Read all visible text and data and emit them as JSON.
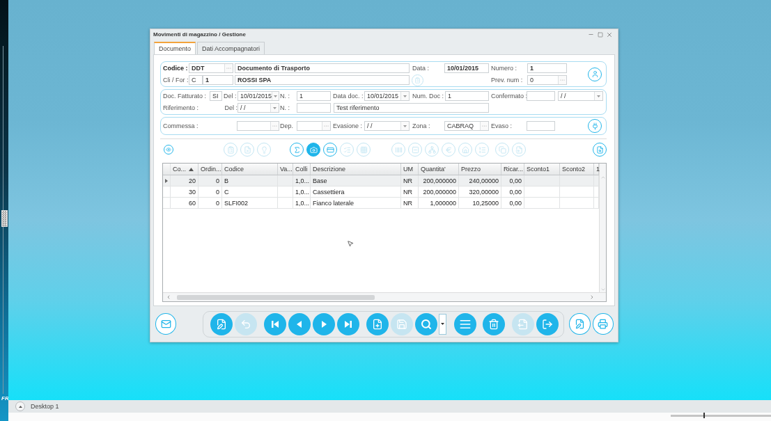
{
  "desktop": {
    "side_label": "FR"
  },
  "window": {
    "title": "Movimenti di magazzino / Gestione"
  },
  "tabs": [
    {
      "label": "Documento",
      "selected": true
    },
    {
      "label": "Dati Accompagnatori",
      "selected": false
    }
  ],
  "header_group": {
    "codice": {
      "label": "Codice :",
      "value": "DDT"
    },
    "descrizione": "Documento di Trasporto",
    "data": {
      "label": "Data :",
      "value": "10/01/2015"
    },
    "numero": {
      "label": "Numero :",
      "value": "1"
    },
    "cli_for": {
      "label": "Cli / For :",
      "type": "C",
      "code": "1",
      "name": "ROSSI SPA"
    },
    "prev_num": {
      "label": "Prev. num :",
      "value": "0"
    }
  },
  "billing_group": {
    "doc_fatturato": {
      "label": "Doc. Fatturato :",
      "value": "SI"
    },
    "del": {
      "label": "Del :",
      "value": "10/01/2015"
    },
    "n": {
      "label": "N. :",
      "value": "1"
    },
    "data_doc": {
      "label": "Data doc. :",
      "value": "10/01/2015"
    },
    "num_doc": {
      "label": "Num. Doc :",
      "value": "1"
    },
    "confermato": {
      "label": "Confermato :",
      "date": "/ /"
    },
    "riferimento": {
      "label": "Riferimento :"
    },
    "rif_del": {
      "label": "Del :",
      "value": "/ /"
    },
    "rif_n": {
      "label": "N. :"
    },
    "rif_text": "Test riferimento"
  },
  "order_group": {
    "commessa": {
      "label": "Commessa :"
    },
    "dep": {
      "label": "Dep."
    },
    "evasione": {
      "label": "Evasione :",
      "value": "/ /"
    },
    "zona": {
      "label": "Zona :",
      "value": "CABRAQ"
    },
    "evaso": {
      "label": "Evaso :"
    }
  },
  "toolbar": {
    "groups": [
      [
        {
          "disabled": true,
          "pressed": false
        },
        {
          "disabled": true,
          "pressed": false
        },
        {
          "disabled": true,
          "pressed": false
        }
      ],
      [
        {
          "disabled": false,
          "pressed": false
        },
        {
          "disabled": false,
          "pressed": true
        },
        {
          "disabled": false,
          "pressed": false
        },
        {
          "disabled": true,
          "pressed": false
        },
        {
          "disabled": true,
          "pressed": false
        }
      ],
      [
        {
          "disabled": true,
          "pressed": false
        },
        {
          "disabled": true,
          "pressed": false
        },
        {
          "disabled": true,
          "pressed": false
        },
        {
          "disabled": true,
          "pressed": false
        },
        {
          "disabled": true,
          "pressed": false
        },
        {
          "disabled": true,
          "pressed": false
        }
      ],
      [
        {
          "disabled": true,
          "pressed": false
        },
        {
          "disabled": true,
          "pressed": false
        }
      ]
    ]
  },
  "grid": {
    "columns": [
      {
        "label": "Co...",
        "sorted": true
      },
      {
        "label": "Ordin...",
        "sorted": false
      },
      {
        "label": "Codice",
        "sorted": false
      },
      {
        "label": "Va...",
        "sorted": false
      },
      {
        "label": "Colli",
        "sorted": false
      },
      {
        "label": "Descrizione",
        "sorted": false
      },
      {
        "label": "UM",
        "sorted": false
      },
      {
        "label": "Quantita'",
        "sorted": false
      },
      {
        "label": "Prezzo",
        "sorted": false
      },
      {
        "label": "Ricar...",
        "sorted": false
      },
      {
        "label": "Sconto1",
        "sorted": false
      },
      {
        "label": "Sconto2",
        "sorted": false
      },
      {
        "label": "1",
        "sorted": false
      }
    ],
    "rows": [
      {
        "selected": true,
        "cells": [
          "20",
          "0",
          "B",
          null,
          "1,0...",
          "Base",
          "NR",
          "200,000000",
          "240,00000",
          "0,00",
          null,
          null,
          null
        ]
      },
      {
        "selected": false,
        "cells": [
          "30",
          "0",
          "C",
          null,
          "1,0...",
          "Cassettiera",
          "NR",
          "200,000000",
          "320,00000",
          "0,00",
          null,
          null,
          null
        ]
      },
      {
        "selected": false,
        "cells": [
          "60",
          "0",
          "SLFI002",
          null,
          "1,0...",
          "Fianco laterale",
          "NR",
          "1,000000",
          "10,25000",
          "0,00",
          null,
          null,
          null
        ]
      }
    ]
  },
  "bottom_bar": {
    "left": [
      {
        "disabled": false
      }
    ],
    "nav_groups": [
      [
        {
          "kind": "round",
          "disabled": false
        },
        {
          "kind": "round",
          "disabled": true
        }
      ],
      [
        {
          "kind": "round",
          "disabled": false
        },
        {
          "kind": "round",
          "disabled": false
        },
        {
          "kind": "round",
          "disabled": false
        },
        {
          "kind": "round",
          "disabled": false
        }
      ],
      [
        {
          "kind": "round",
          "disabled": false
        },
        {
          "kind": "round",
          "disabled": true
        },
        {
          "kind": "round",
          "disabled": false
        },
        {
          "kind": "dropdown",
          "disabled": false
        },
        {
          "kind": "round",
          "disabled": false
        }
      ],
      [
        {
          "kind": "round",
          "disabled": false
        }
      ],
      [
        {
          "kind": "round",
          "disabled": true
        },
        {
          "kind": "round",
          "disabled": false
        }
      ]
    ],
    "right": [
      {
        "disabled": false
      },
      {
        "disabled": false
      }
    ]
  },
  "taskbar": {
    "desktop_label": "Desktop 1"
  }
}
